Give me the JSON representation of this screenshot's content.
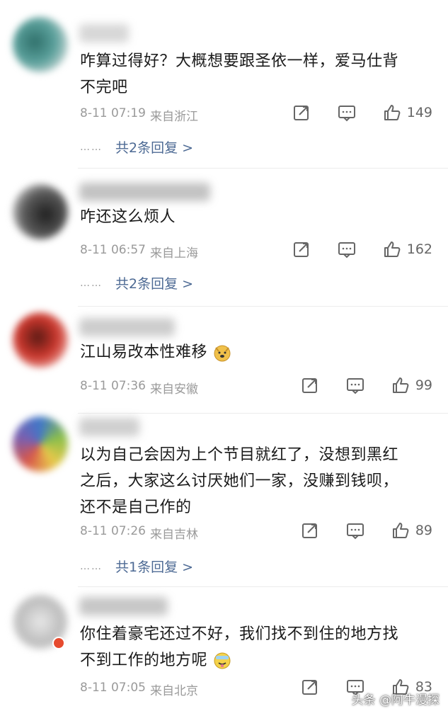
{
  "comments": [
    {
      "text": "咋算过得好？大概想要跟圣依一样，爱马仕背\n不完吧",
      "date": "8-11 07:19",
      "location": "来自浙江",
      "likes": "149",
      "replies": "共2条回复 >",
      "dots": "……",
      "avatar_color": "#4a8a86"
    },
    {
      "text": "咋还这么烦人",
      "date": "8-11 06:57",
      "location": "来自上海",
      "likes": "162",
      "replies": "共2条回复 >",
      "dots": "……",
      "avatar_color": "#555555"
    },
    {
      "text": "江山易改本性难移",
      "date": "8-11 07:36",
      "location": "来自安徽",
      "likes": "99",
      "avatar_color": "#d4453a"
    },
    {
      "text": "以为自己会因为上个节目就红了，没想到黑红\n之后，大家这么讨厌她们一家，没赚到钱呗，\n还不是自己作的",
      "date": "8-11 07:26",
      "location": "来自吉林",
      "likes": "89",
      "replies": "共1条回复 >",
      "dots": "……",
      "avatar_color": "#6b8f3a"
    },
    {
      "text": "你住着豪宅还过不好，我们找不到住的地方找\n不到工作的地方呢",
      "date": "8-11 07:05",
      "location": "来自北京",
      "likes": "83",
      "avatar_color": "#bbbbbb"
    }
  ],
  "watermark": "头条 @阿牛漫探"
}
